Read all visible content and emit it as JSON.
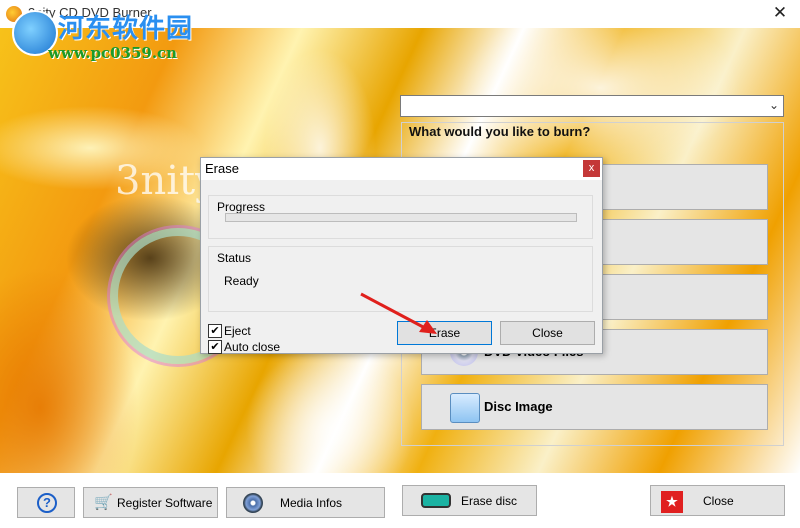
{
  "window": {
    "title": "3nity CD DVD Burner",
    "close_glyph": "✕"
  },
  "watermark": {
    "title": "河东软件园",
    "url": "www.pc0359.cn"
  },
  "background": {
    "logo_text": "3nity"
  },
  "main": {
    "combo_value": "",
    "prompt": "What would you like to burn?",
    "options": [
      {
        "label": "",
        "icon": "disc-icon"
      },
      {
        "label": "",
        "icon": "disc-icon"
      },
      {
        "label": "",
        "icon": "disc-icon"
      },
      {
        "label": "DVD Video Files",
        "icon": "disc-icon"
      },
      {
        "label": "Disc Image",
        "icon": "disc-image-icon"
      }
    ]
  },
  "toolbar": {
    "help_glyph": "?",
    "register_label": "Register Software",
    "media_label": "Media Infos",
    "erase_label": "Erase disc",
    "close_label": "Close"
  },
  "erase_dialog": {
    "title": "Erase",
    "close_glyph": "x",
    "progress_label": "Progress",
    "progress_value": 0,
    "status_label": "Status",
    "status_value": "Ready",
    "eject": {
      "label": "Eject",
      "checked": true
    },
    "auto_close": {
      "label": "Auto close",
      "checked": true
    },
    "erase_button": "Erase",
    "close_button": "Close"
  },
  "colors": {
    "accent_red": "#e0201c",
    "progress_green": "#06b025",
    "dialog_close": "#c43838"
  }
}
